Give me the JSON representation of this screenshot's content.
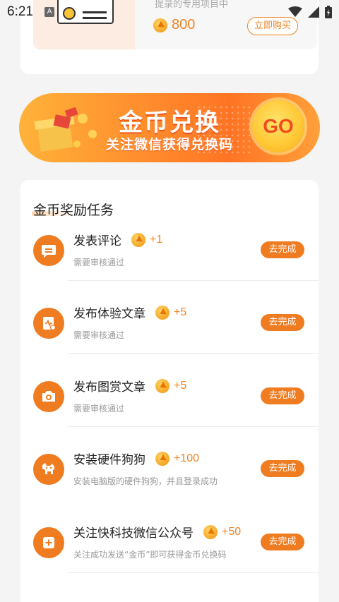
{
  "status_bar": {
    "time": "6:21",
    "notification_letter": "A",
    "icons": [
      "wifi-icon",
      "signal-icon",
      "battery-icon"
    ]
  },
  "product": {
    "subtitle": "提录的专用项目中",
    "price": "800",
    "buy_label": "立即购买"
  },
  "banner": {
    "title": "金币兑换",
    "subtitle": "关注微信获得兑换码",
    "go_label": "GO"
  },
  "tasks": {
    "title": "金币奖励任务",
    "items": [
      {
        "name": "发表评论",
        "reward": "+1",
        "desc": "需要审核通过",
        "button": "去完成",
        "icon": "comment-icon"
      },
      {
        "name": "发布体验文章",
        "reward": "+5",
        "desc": "需要审核通过",
        "button": "去完成",
        "icon": "article-icon"
      },
      {
        "name": "发布图赏文章",
        "reward": "+5",
        "desc": "需要审核通过",
        "button": "去完成",
        "icon": "camera-icon"
      },
      {
        "name": "安装硬件狗狗",
        "reward": "+100",
        "desc": "安装电脑版的硬件狗狗，并且登录成功",
        "button": "去完成",
        "icon": "dog-icon"
      },
      {
        "name": "关注快科技微信公众号",
        "reward": "+50",
        "desc": "关注成功发送“金币”即可获得金币兑换码",
        "button": "去完成",
        "icon": "plus-icon"
      }
    ]
  },
  "colors": {
    "accent": "#f07c22",
    "background": "#f4f4f4"
  }
}
